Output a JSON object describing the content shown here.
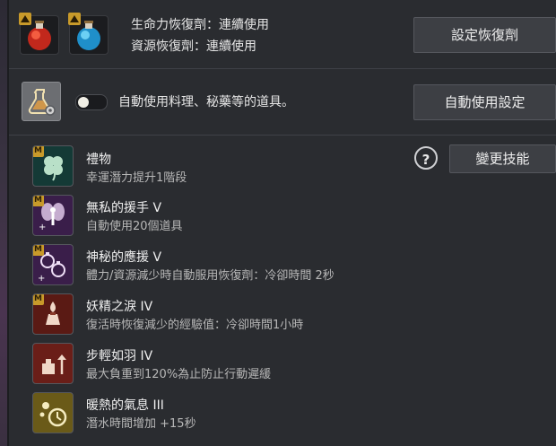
{
  "recovery": {
    "hp_line": "生命力恢復劑：連續使用",
    "mp_line": "資源恢復劑：連續使用",
    "set_button": "設定恢復劑"
  },
  "auto_use": {
    "toggle_on": false,
    "label": "自動使用料理、秘藥等的道具。",
    "settings_button": "自動使用設定"
  },
  "skills_header": {
    "help_label": "?",
    "change_button": "變更技能"
  },
  "skills": [
    {
      "badge": "M",
      "name": "禮物",
      "desc": "幸運潛力提升1階段",
      "icon": "clover-icon"
    },
    {
      "badge": "M",
      "name": "無私的援手 V",
      "desc": "自動使用20個道具",
      "icon": "fairy-icon"
    },
    {
      "badge": "M",
      "name": "神秘的應援 V",
      "desc": "體力/資源減少時自動服用恢復劑：冷卻時間 2秒",
      "icon": "potions-icon"
    },
    {
      "badge": "M",
      "name": "妖精之淚 IV",
      "desc": "復活時恢復減少的經驗值：冷卻時間1小時",
      "icon": "tear-vial-icon"
    },
    {
      "badge": "",
      "name": "步輕如羽 IV",
      "desc": "最大負重到120%為止防止行動遲緩",
      "icon": "weight-up-icon"
    },
    {
      "badge": "",
      "name": "暖熱的氣息 III",
      "desc": "潛水時間增加 +15秒",
      "icon": "breath-timer-icon"
    }
  ],
  "colors": {
    "badge_gold": "#c89a2a",
    "panel_bg": "#2a2c30",
    "button_bg": "#3d3f44"
  }
}
